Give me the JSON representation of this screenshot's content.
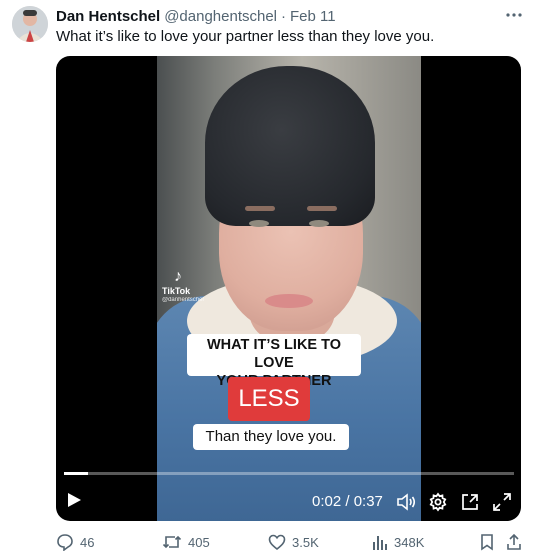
{
  "tweet": {
    "author_name": "Dan Hentschel",
    "handle": "@danghentschel",
    "separator": "·",
    "date": "Feb 11",
    "text": "What it’s like to love your partner less than they love you.",
    "more_icon": "more-icon"
  },
  "video": {
    "tiktok_label": "TikTok",
    "tiktok_handle": "@danhentschel",
    "caption_line1": "WHAT IT’S LIKE TO LOVE",
    "caption_line2": "YOUR PARTNER",
    "caption_less": "LESS",
    "caption_line3": "Than they love you.",
    "progress": 0.054,
    "time_display": "0:02 / 0:37",
    "caption_less_color": "#e03b3b"
  },
  "actions": {
    "replies": "46",
    "reposts": "405",
    "likes": "3.5K",
    "views": "348K"
  },
  "colors": {
    "text": "#0f1419",
    "secondary": "#536471",
    "video_bg": "#000000"
  }
}
